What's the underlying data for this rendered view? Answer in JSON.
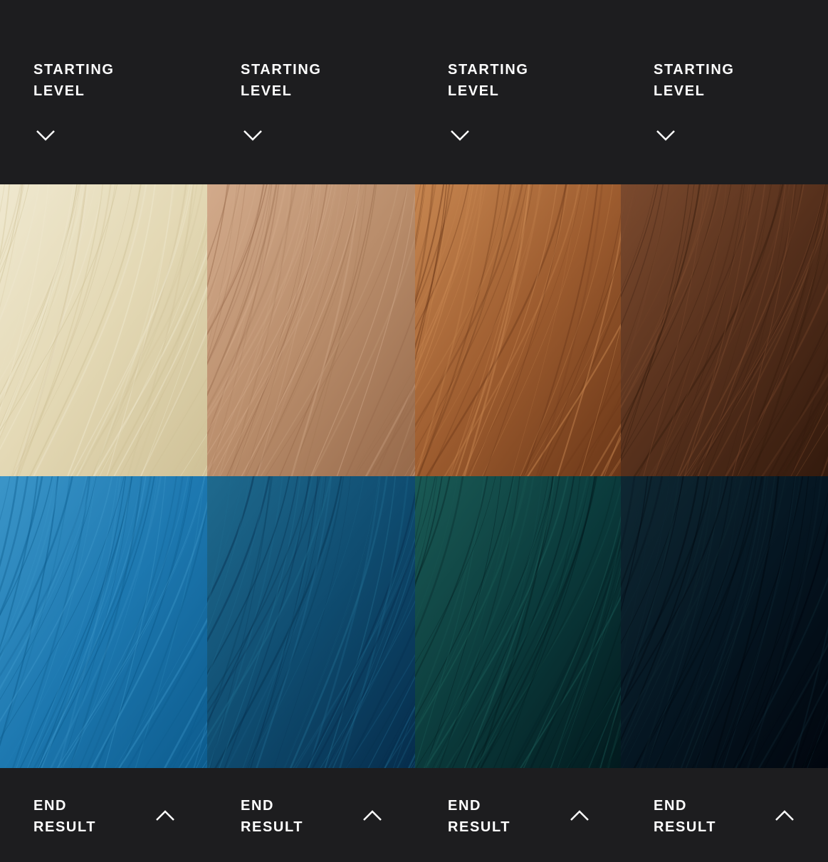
{
  "starting_level": {
    "columns": [
      {
        "line1": "STARTING",
        "line2": "LEVEL",
        "icon": "chevron-down-icon"
      },
      {
        "line1": "STARTING",
        "line2": "LEVEL",
        "icon": "chevron-down-icon"
      },
      {
        "line1": "STARTING",
        "line2": "LEVEL",
        "icon": "chevron-down-icon"
      },
      {
        "line1": "STARTING",
        "line2": "LEVEL",
        "icon": "chevron-down-icon"
      }
    ],
    "swatch_colors": [
      {
        "light": "#efe8cf",
        "mid": "#e3d8b4",
        "dark": "#cfc197"
      },
      {
        "light": "#d2aa8b",
        "mid": "#b98d6b",
        "dark": "#96694a"
      },
      {
        "light": "#c78650",
        "mid": "#9d5c2f",
        "dark": "#6b3718"
      },
      {
        "light": "#7b4a2e",
        "mid": "#56301c",
        "dark": "#331a0d"
      }
    ]
  },
  "end_result": {
    "columns": [
      {
        "line1": "END",
        "line2": "RESULT",
        "icon": "chevron-up-icon"
      },
      {
        "line1": "END",
        "line2": "RESULT",
        "icon": "chevron-up-icon"
      },
      {
        "line1": "END",
        "line2": "RESULT",
        "icon": "chevron-up-icon"
      },
      {
        "line1": "END",
        "line2": "RESULT",
        "icon": "chevron-up-icon"
      }
    ],
    "swatch_colors": [
      {
        "light": "#3b95c8",
        "mid": "#1d78b0",
        "dark": "#0d5c8e"
      },
      {
        "light": "#1f6a8e",
        "mid": "#0f4c70",
        "dark": "#062d4c"
      },
      {
        "light": "#1a5a55",
        "mid": "#0b3b3c",
        "dark": "#021a1e"
      },
      {
        "light": "#0f2833",
        "mid": "#051622",
        "dark": "#01060e"
      }
    ]
  },
  "colors": {
    "background": "#1d1d1f",
    "text": "#ffffff"
  }
}
